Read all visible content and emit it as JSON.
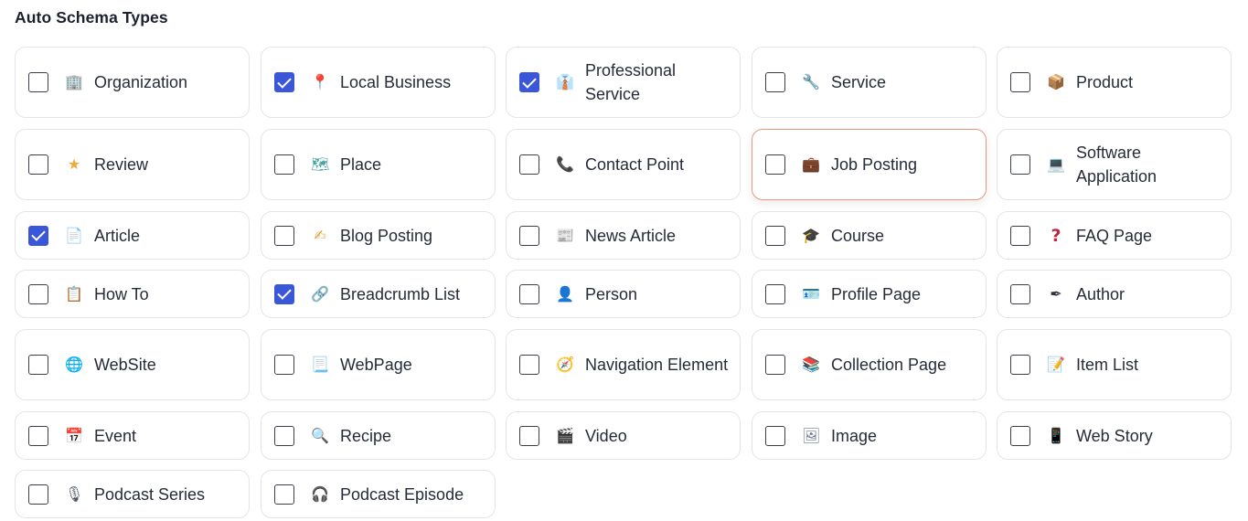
{
  "section": {
    "title": "Auto Schema Types"
  },
  "items": [
    {
      "label": "Organization",
      "checked": false,
      "icon": "office-building-icon",
      "glyph": "🏢",
      "color": "#8aa7c7"
    },
    {
      "label": "Local Business",
      "checked": true,
      "icon": "map-pin-icon",
      "glyph": "📍",
      "color": "#d64545"
    },
    {
      "label": "Professional Service",
      "checked": true,
      "icon": "necktie-icon",
      "glyph": "👔",
      "color": "#5a7fcf"
    },
    {
      "label": "Service",
      "checked": false,
      "icon": "wrench-icon",
      "glyph": "🔧",
      "color": "#7d8794"
    },
    {
      "label": "Product",
      "checked": false,
      "icon": "package-icon",
      "glyph": "📦",
      "color": "#b3704a"
    },
    {
      "label": "Review",
      "checked": false,
      "icon": "star-icon",
      "glyph": "★",
      "color": "#f2a93b"
    },
    {
      "label": "Place",
      "checked": false,
      "icon": "map-icon",
      "glyph": "🗺",
      "color": "#4aa3a0"
    },
    {
      "label": "Contact Point",
      "checked": false,
      "icon": "telephone-icon",
      "glyph": "📞",
      "color": "#3a3f4b"
    },
    {
      "label": "Job Posting",
      "checked": false,
      "icon": "briefcase-icon",
      "glyph": "💼",
      "color": "#a45a2a"
    },
    {
      "label": "Software Application",
      "checked": false,
      "icon": "laptop-icon",
      "glyph": "💻",
      "color": "#6f86a8"
    },
    {
      "label": "Article",
      "checked": true,
      "icon": "document-icon",
      "glyph": "📄",
      "color": "#9aa3b0"
    },
    {
      "label": "Blog Posting",
      "checked": false,
      "icon": "writing-hand-icon",
      "glyph": "✍",
      "color": "#e0a23c"
    },
    {
      "label": "News Article",
      "checked": false,
      "icon": "newspaper-icon",
      "glyph": "📰",
      "color": "#8c96a5"
    },
    {
      "label": "Course",
      "checked": false,
      "icon": "graduation-cap-icon",
      "glyph": "🎓",
      "color": "#2d3140"
    },
    {
      "label": "FAQ Page",
      "checked": false,
      "icon": "question-mark-icon",
      "glyph": "?",
      "color": "#c0263b"
    },
    {
      "label": "How To",
      "checked": false,
      "icon": "clipboard-icon",
      "glyph": "📋",
      "color": "#c7854a"
    },
    {
      "label": "Breadcrumb List",
      "checked": true,
      "icon": "link-icon",
      "glyph": "🔗",
      "color": "#8d96a3"
    },
    {
      "label": "Person",
      "checked": false,
      "icon": "person-icon",
      "glyph": "👤",
      "color": "#3d5a80"
    },
    {
      "label": "Profile Page",
      "checked": false,
      "icon": "id-card-icon",
      "glyph": "🪪",
      "color": "#4a5567"
    },
    {
      "label": "Author",
      "checked": false,
      "icon": "pen-icon",
      "glyph": "✒",
      "color": "#2f333d"
    },
    {
      "label": "WebSite",
      "checked": false,
      "icon": "globe-icon",
      "glyph": "🌐",
      "color": "#3e8fd6"
    },
    {
      "label": "WebPage",
      "checked": false,
      "icon": "web-page-icon",
      "glyph": "📃",
      "color": "#a7afba"
    },
    {
      "label": "Navigation Element",
      "checked": false,
      "icon": "compass-icon",
      "glyph": "🧭",
      "color": "#e0902c"
    },
    {
      "label": "Collection Page",
      "checked": false,
      "icon": "books-icon",
      "glyph": "📚",
      "color": "#6b7fb5"
    },
    {
      "label": "Item List",
      "checked": false,
      "icon": "memo-icon",
      "glyph": "📝",
      "color": "#c99a3c"
    },
    {
      "label": "Event",
      "checked": false,
      "icon": "calendar-icon",
      "glyph": "📅",
      "color": "#c94444"
    },
    {
      "label": "Recipe",
      "checked": false,
      "icon": "magnifier-icon",
      "glyph": "🔍",
      "color": "#2f3440"
    },
    {
      "label": "Video",
      "checked": false,
      "icon": "clapperboard-icon",
      "glyph": "🎬",
      "color": "#3f8f4a"
    },
    {
      "label": "Image",
      "checked": false,
      "icon": "framed-picture-icon",
      "glyph": "🖼",
      "color": "#6c7a8f"
    },
    {
      "label": "Web Story",
      "checked": false,
      "icon": "mobile-phone-icon",
      "glyph": "📱",
      "color": "#3a4456"
    },
    {
      "label": "Podcast Series",
      "checked": false,
      "icon": "microphone-icon",
      "glyph": "🎙",
      "color": "#4d535f"
    },
    {
      "label": "Podcast Episode",
      "checked": false,
      "icon": "headphones-icon",
      "glyph": "🎧",
      "color": "#4d535f"
    }
  ]
}
